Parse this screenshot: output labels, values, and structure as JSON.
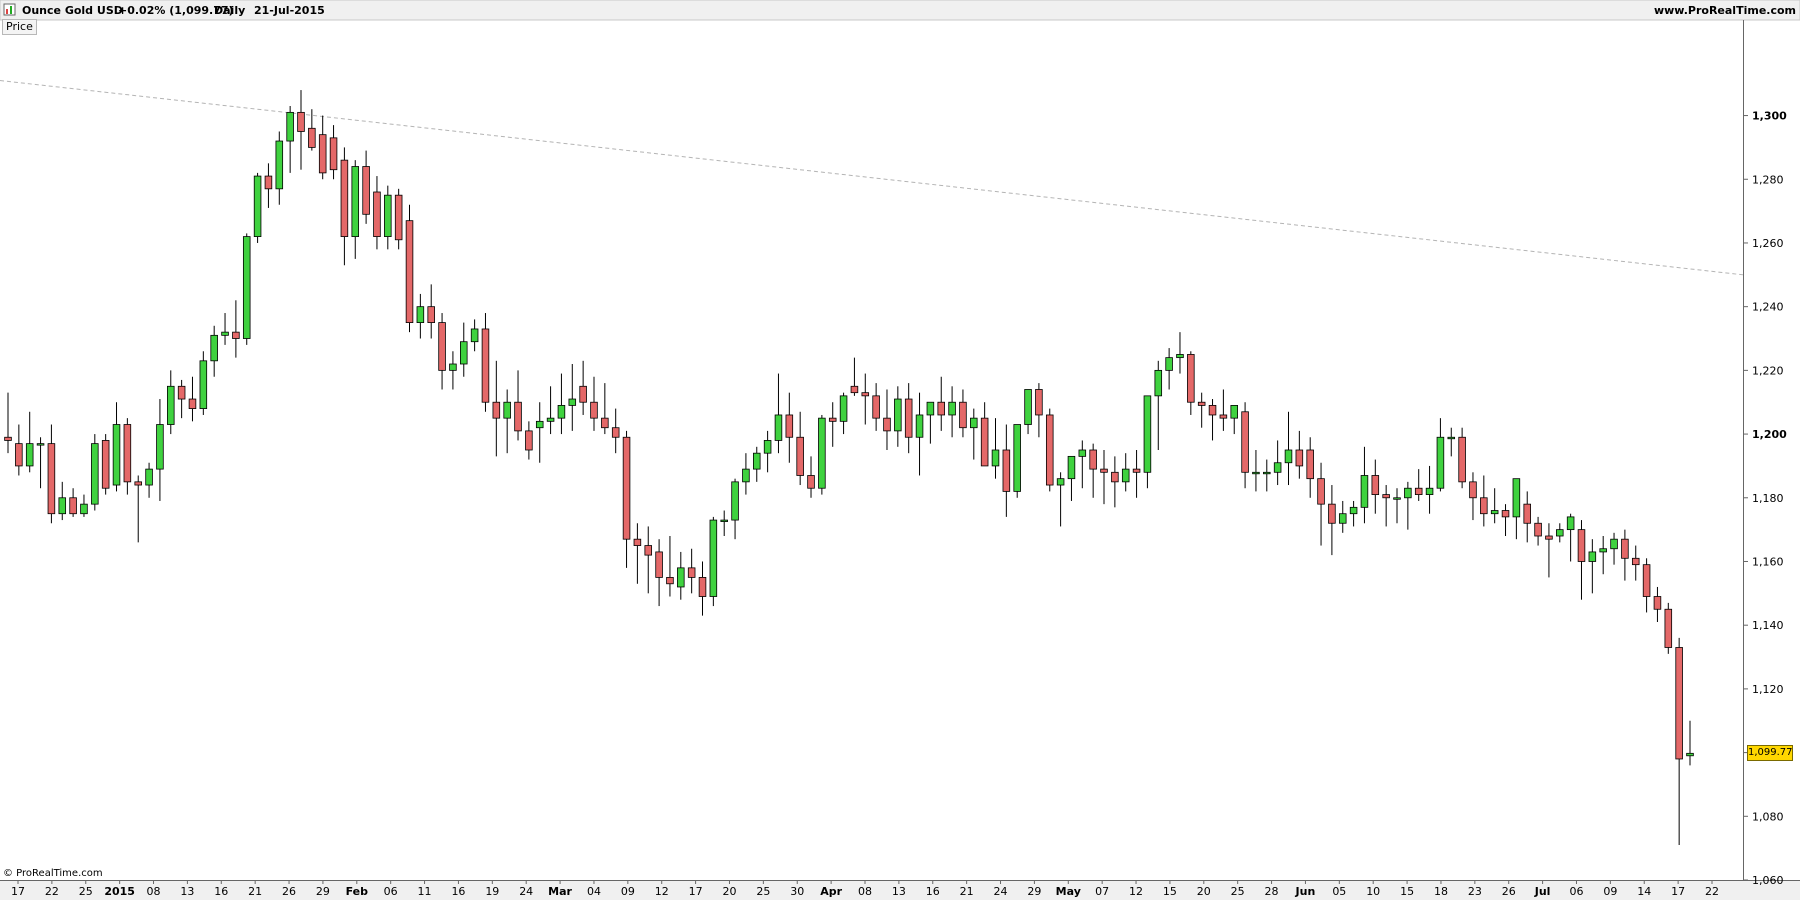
{
  "header": {
    "instrument": "Ounce Gold USD",
    "change": "+0.02% (1,099.77)",
    "timeframe": "Daily",
    "date": "21-Jul-2015",
    "site": "www.ProRealTime.com"
  },
  "panel": {
    "price_button": "Price"
  },
  "footer": {
    "copyright": "© ProRealTime.com"
  },
  "colors": {
    "up_candle": "#3fd23f",
    "down_candle": "#e46868",
    "candle_outline": "#000000",
    "last_price_badge": "#ffd700",
    "trendline": "#b4b4b4"
  },
  "chart_data": {
    "type": "candlestick",
    "title": "Ounce Gold USD",
    "timeframe": "Daily",
    "y_axis": {
      "range": [
        1060,
        1330
      ],
      "ticks": [
        "1,060",
        "1,080",
        "1,100",
        "1,120",
        "1,140",
        "1,160",
        "1,180",
        "1,200",
        "1,220",
        "1,240",
        "1,260",
        "1,280",
        "1,300"
      ]
    },
    "x_axis_labels": [
      {
        "text": "17",
        "bold": false
      },
      {
        "text": "22",
        "bold": false
      },
      {
        "text": "25",
        "bold": false
      },
      {
        "text": "2015",
        "bold": true
      },
      {
        "text": "08",
        "bold": false
      },
      {
        "text": "13",
        "bold": false
      },
      {
        "text": "16",
        "bold": false
      },
      {
        "text": "21",
        "bold": false
      },
      {
        "text": "26",
        "bold": false
      },
      {
        "text": "29",
        "bold": false
      },
      {
        "text": "Feb",
        "bold": true
      },
      {
        "text": "06",
        "bold": false
      },
      {
        "text": "11",
        "bold": false
      },
      {
        "text": "16",
        "bold": false
      },
      {
        "text": "19",
        "bold": false
      },
      {
        "text": "24",
        "bold": false
      },
      {
        "text": "Mar",
        "bold": true
      },
      {
        "text": "04",
        "bold": false
      },
      {
        "text": "09",
        "bold": false
      },
      {
        "text": "12",
        "bold": false
      },
      {
        "text": "17",
        "bold": false
      },
      {
        "text": "20",
        "bold": false
      },
      {
        "text": "25",
        "bold": false
      },
      {
        "text": "30",
        "bold": false
      },
      {
        "text": "Apr",
        "bold": true
      },
      {
        "text": "08",
        "bold": false
      },
      {
        "text": "13",
        "bold": false
      },
      {
        "text": "16",
        "bold": false
      },
      {
        "text": "21",
        "bold": false
      },
      {
        "text": "24",
        "bold": false
      },
      {
        "text": "29",
        "bold": false
      },
      {
        "text": "May",
        "bold": true
      },
      {
        "text": "07",
        "bold": false
      },
      {
        "text": "12",
        "bold": false
      },
      {
        "text": "15",
        "bold": false
      },
      {
        "text": "20",
        "bold": false
      },
      {
        "text": "25",
        "bold": false
      },
      {
        "text": "28",
        "bold": false
      },
      {
        "text": "Jun",
        "bold": true
      },
      {
        "text": "05",
        "bold": false
      },
      {
        "text": "10",
        "bold": false
      },
      {
        "text": "15",
        "bold": false
      },
      {
        "text": "18",
        "bold": false
      },
      {
        "text": "23",
        "bold": false
      },
      {
        "text": "26",
        "bold": false
      },
      {
        "text": "Jul",
        "bold": true
      },
      {
        "text": "06",
        "bold": false
      },
      {
        "text": "09",
        "bold": false
      },
      {
        "text": "14",
        "bold": false
      },
      {
        "text": "17",
        "bold": false
      },
      {
        "text": "22",
        "bold": false
      }
    ],
    "trendline": {
      "start": 1311,
      "end": 1250
    },
    "last_price": "1,099.77",
    "last_price_value": 1099.77,
    "candles": [
      [
        1199,
        1213,
        1194,
        1198
      ],
      [
        1197,
        1203,
        1187,
        1190
      ],
      [
        1190,
        1207,
        1188,
        1197
      ],
      [
        1197,
        1199,
        1183,
        1197
      ],
      [
        1197,
        1203,
        1172,
        1175
      ],
      [
        1175,
        1185,
        1173,
        1180
      ],
      [
        1180,
        1183,
        1174,
        1175
      ],
      [
        1175,
        1181,
        1174,
        1178
      ],
      [
        1178,
        1200,
        1176,
        1197
      ],
      [
        1198,
        1200,
        1181,
        1183
      ],
      [
        1184,
        1210,
        1182,
        1203
      ],
      [
        1203,
        1205,
        1181,
        1185
      ],
      [
        1185,
        1187,
        1166,
        1184
      ],
      [
        1184,
        1191,
        1180,
        1189
      ],
      [
        1189,
        1211,
        1179,
        1203
      ],
      [
        1203,
        1220,
        1200,
        1215
      ],
      [
        1215,
        1217,
        1205,
        1211
      ],
      [
        1211,
        1218,
        1204,
        1208
      ],
      [
        1208,
        1226,
        1206,
        1223
      ],
      [
        1223,
        1234,
        1218,
        1231
      ],
      [
        1231,
        1238,
        1228,
        1232
      ],
      [
        1232,
        1242,
        1224,
        1230
      ],
      [
        1230,
        1263,
        1228,
        1262
      ],
      [
        1262,
        1282,
        1260,
        1281
      ],
      [
        1281,
        1285,
        1271,
        1277
      ],
      [
        1277,
        1295,
        1272,
        1292
      ],
      [
        1292,
        1303,
        1282,
        1301
      ],
      [
        1301,
        1308,
        1283,
        1295
      ],
      [
        1296,
        1302,
        1289,
        1290
      ],
      [
        1294,
        1300,
        1280,
        1282
      ],
      [
        1293,
        1297,
        1280,
        1283
      ],
      [
        1286,
        1290,
        1253,
        1262
      ],
      [
        1262,
        1286,
        1255,
        1284
      ],
      [
        1284,
        1289,
        1266,
        1269
      ],
      [
        1276,
        1281,
        1258,
        1262
      ],
      [
        1262,
        1278,
        1258,
        1275
      ],
      [
        1275,
        1277,
        1258,
        1261
      ],
      [
        1267,
        1272,
        1232,
        1235
      ],
      [
        1235,
        1244,
        1230,
        1240
      ],
      [
        1240,
        1247,
        1230,
        1235
      ],
      [
        1235,
        1238,
        1214,
        1220
      ],
      [
        1220,
        1226,
        1214,
        1222
      ],
      [
        1222,
        1235,
        1218,
        1229
      ],
      [
        1229,
        1236,
        1226,
        1233
      ],
      [
        1233,
        1238,
        1207,
        1210
      ],
      [
        1210,
        1223,
        1193,
        1205
      ],
      [
        1205,
        1214,
        1194,
        1210
      ],
      [
        1210,
        1220,
        1198,
        1201
      ],
      [
        1201,
        1204,
        1192,
        1195
      ],
      [
        1202,
        1210,
        1191,
        1204
      ],
      [
        1204,
        1215,
        1200,
        1205
      ],
      [
        1205,
        1219,
        1200,
        1209
      ],
      [
        1209,
        1222,
        1201,
        1211
      ],
      [
        1215,
        1223,
        1206,
        1210
      ],
      [
        1210,
        1218,
        1201,
        1205
      ],
      [
        1205,
        1216,
        1200,
        1202
      ],
      [
        1202,
        1208,
        1194,
        1199
      ],
      [
        1199,
        1201,
        1158,
        1167
      ],
      [
        1167,
        1172,
        1153,
        1165
      ],
      [
        1165,
        1171,
        1150,
        1162
      ],
      [
        1163,
        1167,
        1146,
        1155
      ],
      [
        1155,
        1168,
        1149,
        1153
      ],
      [
        1152,
        1163,
        1148,
        1158
      ],
      [
        1158,
        1164,
        1150,
        1155
      ],
      [
        1155,
        1160,
        1143,
        1149
      ],
      [
        1149,
        1174,
        1146,
        1173
      ],
      [
        1173,
        1176,
        1168,
        1173
      ],
      [
        1173,
        1186,
        1167,
        1185
      ],
      [
        1185,
        1194,
        1181,
        1189
      ],
      [
        1189,
        1196,
        1185,
        1194
      ],
      [
        1194,
        1201,
        1188,
        1198
      ],
      [
        1198,
        1219,
        1194,
        1206
      ],
      [
        1206,
        1213,
        1191,
        1199
      ],
      [
        1199,
        1207,
        1184,
        1187
      ],
      [
        1187,
        1193,
        1180,
        1183
      ],
      [
        1183,
        1206,
        1181,
        1205
      ],
      [
        1205,
        1210,
        1196,
        1204
      ],
      [
        1204,
        1213,
        1200,
        1212
      ],
      [
        1215,
        1224,
        1212,
        1213
      ],
      [
        1213,
        1219,
        1203,
        1212
      ],
      [
        1212,
        1216,
        1201,
        1205
      ],
      [
        1205,
        1214,
        1195,
        1201
      ],
      [
        1201,
        1215,
        1196,
        1211
      ],
      [
        1211,
        1216,
        1194,
        1199
      ],
      [
        1199,
        1213,
        1187,
        1206
      ],
      [
        1206,
        1210,
        1197,
        1210
      ],
      [
        1210,
        1218,
        1201,
        1206
      ],
      [
        1206,
        1215,
        1199,
        1210
      ],
      [
        1210,
        1214,
        1199,
        1202
      ],
      [
        1202,
        1208,
        1192,
        1205
      ],
      [
        1205,
        1210,
        1192,
        1190
      ],
      [
        1190,
        1205,
        1186,
        1195
      ],
      [
        1195,
        1203,
        1174,
        1182
      ],
      [
        1182,
        1201,
        1180,
        1203
      ],
      [
        1203,
        1214,
        1200,
        1214
      ],
      [
        1214,
        1216,
        1199,
        1206
      ],
      [
        1206,
        1208,
        1182,
        1184
      ],
      [
        1184,
        1188,
        1171,
        1186
      ],
      [
        1186,
        1190,
        1179,
        1193
      ],
      [
        1193,
        1198,
        1183,
        1195
      ],
      [
        1195,
        1197,
        1180,
        1189
      ],
      [
        1189,
        1195,
        1178,
        1188
      ],
      [
        1188,
        1193,
        1177,
        1185
      ],
      [
        1185,
        1194,
        1182,
        1189
      ],
      [
        1189,
        1195,
        1180,
        1188
      ],
      [
        1188,
        1207,
        1183,
        1212
      ],
      [
        1212,
        1223,
        1195,
        1220
      ],
      [
        1220,
        1227,
        1214,
        1224
      ],
      [
        1224,
        1232,
        1219,
        1225
      ],
      [
        1225,
        1226,
        1206,
        1210
      ],
      [
        1210,
        1213,
        1202,
        1209
      ],
      [
        1209,
        1211,
        1198,
        1206
      ],
      [
        1206,
        1214,
        1201,
        1205
      ],
      [
        1205,
        1207,
        1200,
        1209
      ],
      [
        1207,
        1210,
        1183,
        1188
      ],
      [
        1188,
        1195,
        1182,
        1188
      ],
      [
        1188,
        1192,
        1182,
        1188
      ],
      [
        1188,
        1198,
        1184,
        1191
      ],
      [
        1191,
        1207,
        1184,
        1195
      ],
      [
        1195,
        1201,
        1186,
        1190
      ],
      [
        1195,
        1199,
        1180,
        1186
      ],
      [
        1186,
        1191,
        1165,
        1178
      ],
      [
        1178,
        1184,
        1162,
        1172
      ],
      [
        1172,
        1179,
        1169,
        1175
      ],
      [
        1175,
        1179,
        1171,
        1177
      ],
      [
        1177,
        1196,
        1172,
        1187
      ],
      [
        1187,
        1192,
        1175,
        1181
      ],
      [
        1181,
        1184,
        1171,
        1180
      ],
      [
        1180,
        1183,
        1172,
        1180
      ],
      [
        1180,
        1185,
        1170,
        1183
      ],
      [
        1183,
        1189,
        1179,
        1181
      ],
      [
        1181,
        1190,
        1175,
        1183
      ],
      [
        1183,
        1205,
        1182,
        1199
      ],
      [
        1199,
        1202,
        1193,
        1199
      ],
      [
        1199,
        1202,
        1183,
        1185
      ],
      [
        1185,
        1188,
        1173,
        1180
      ],
      [
        1180,
        1187,
        1171,
        1175
      ],
      [
        1175,
        1183,
        1172,
        1176
      ],
      [
        1176,
        1178,
        1168,
        1174
      ],
      [
        1174,
        1181,
        1167,
        1186
      ],
      [
        1178,
        1182,
        1166,
        1172
      ],
      [
        1172,
        1174,
        1165,
        1168
      ],
      [
        1168,
        1172,
        1155,
        1167
      ],
      [
        1168,
        1172,
        1166,
        1170
      ],
      [
        1170,
        1175,
        1160,
        1174
      ],
      [
        1170,
        1173,
        1148,
        1160
      ],
      [
        1160,
        1167,
        1150,
        1163
      ],
      [
        1163,
        1168,
        1156,
        1164
      ],
      [
        1164,
        1169,
        1159,
        1167
      ],
      [
        1167,
        1170,
        1154,
        1161
      ],
      [
        1161,
        1165,
        1154,
        1159
      ],
      [
        1159,
        1161,
        1144,
        1149
      ],
      [
        1149,
        1152,
        1141,
        1145
      ],
      [
        1145,
        1147,
        1131,
        1133
      ],
      [
        1133,
        1136,
        1071,
        1098
      ],
      [
        1099,
        1110,
        1096,
        1099.77
      ]
    ]
  }
}
